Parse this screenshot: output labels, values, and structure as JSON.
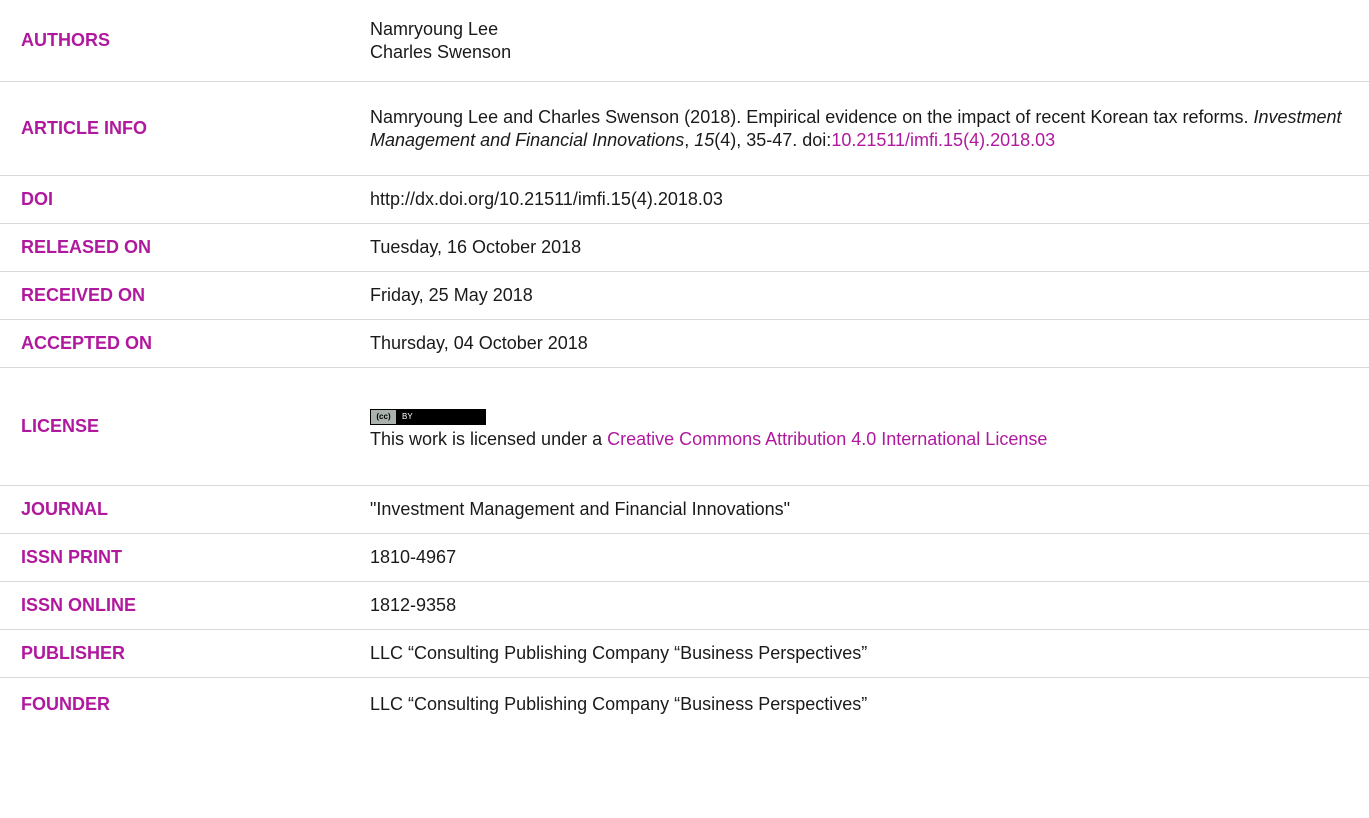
{
  "rows": {
    "authors": {
      "label": "AUTHORS",
      "names": [
        "Namryoung Lee",
        "Charles Swenson"
      ]
    },
    "article_info": {
      "label": "ARTICLE INFO",
      "text_before": "Namryoung Lee and Charles Swenson (2018). Empirical evidence on the impact of recent Korean tax reforms. ",
      "journal_italic": "Investment Management and Financial Innovations",
      "comma1": ", ",
      "volume_italic": "15",
      "text_after": "(4), 35-47. doi:",
      "doi_link": "10.21511/imfi.15(4).2018.03"
    },
    "doi": {
      "label": "DOI",
      "value": "http://dx.doi.org/10.21511/imfi.15(4).2018.03"
    },
    "released_on": {
      "label": "RELEASED ON",
      "value": "Tuesday, 16 October 2018"
    },
    "received_on": {
      "label": "RECEIVED ON",
      "value": "Friday, 25 May 2018"
    },
    "accepted_on": {
      "label": "ACCEPTED ON",
      "value": "Thursday, 04 October 2018"
    },
    "license": {
      "label": "LICENSE",
      "badge_cc": "(cc)",
      "badge_by": "BY",
      "text_before": "This work is licensed under a ",
      "link_text": "Creative Commons Attribution 4.0 International License"
    },
    "journal": {
      "label": "JOURNAL",
      "value": "\"Investment Management and Financial Innovations\""
    },
    "issn_print": {
      "label": "ISSN PRINT",
      "value": "1810-4967"
    },
    "issn_online": {
      "label": "ISSN ONLINE",
      "value": "1812-9358"
    },
    "publisher": {
      "label": "PUBLISHER",
      "value": "LLC “Consulting Publishing Company “Business Perspectives”"
    },
    "founder": {
      "label": "FOUNDER",
      "value": "LLC “Consulting Publishing Company “Business Perspectives”"
    }
  },
  "colors": {
    "label_accent": "#b0199e",
    "text": "#1a1a1a",
    "divider": "#d9d9d9"
  }
}
